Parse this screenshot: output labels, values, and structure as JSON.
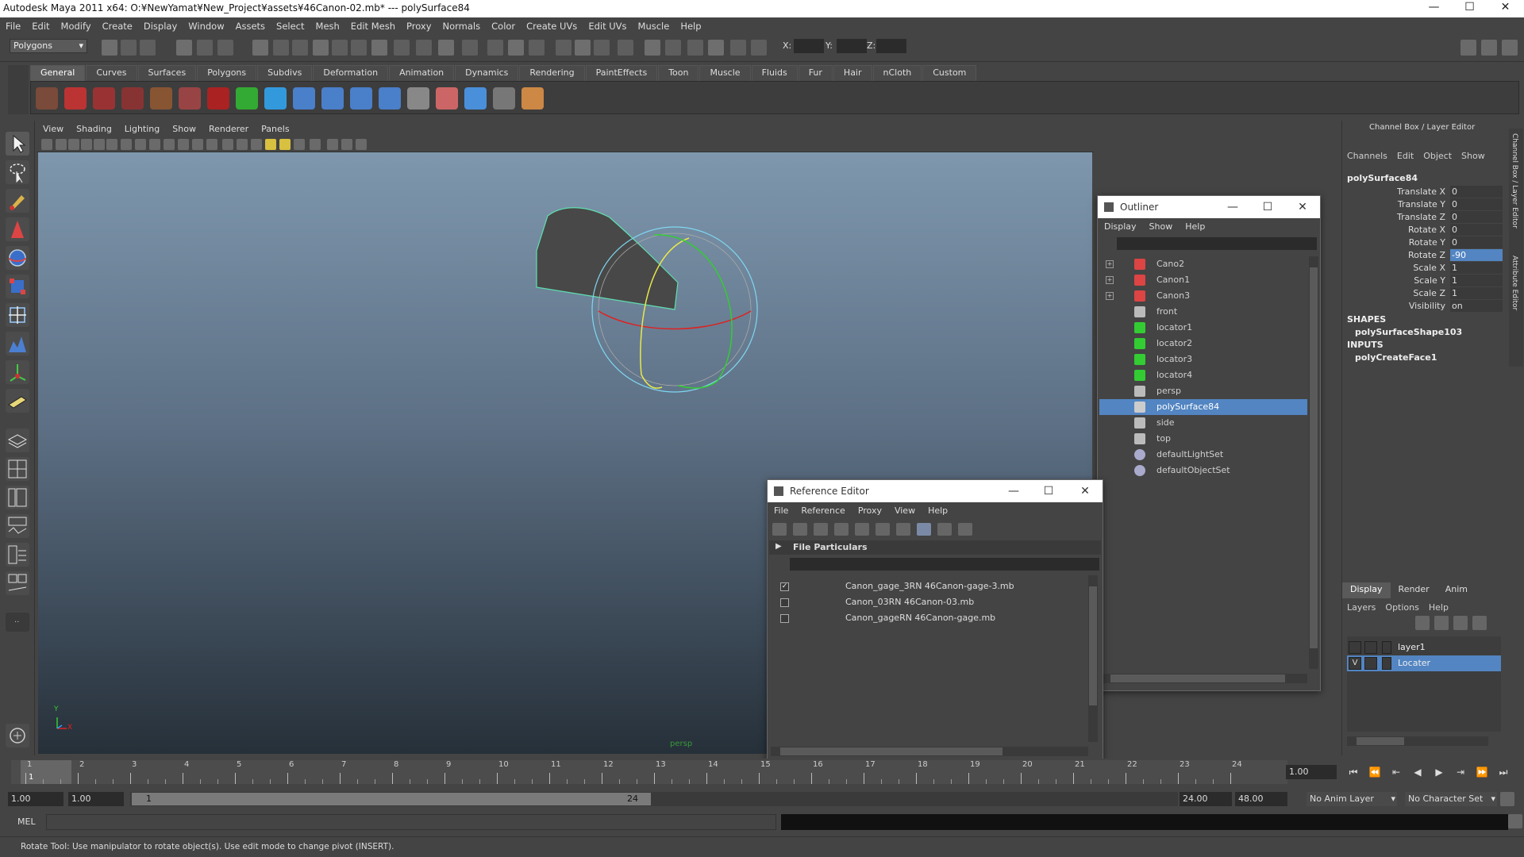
{
  "app": {
    "title": "Autodesk Maya 2011 x64: O:¥NewYamat¥New_Project¥assets¥46Canon-02.mb*   ---   polySurface84",
    "minimize": "—",
    "maximize": "☐",
    "close": "✕"
  },
  "main_menu": [
    "File",
    "Edit",
    "Modify",
    "Create",
    "Display",
    "Window",
    "Assets",
    "Select",
    "Mesh",
    "Edit Mesh",
    "Proxy",
    "Normals",
    "Color",
    "Create UVs",
    "Edit UVs",
    "Muscle",
    "Help"
  ],
  "status_line": {
    "mode": "Polygons",
    "x_label": "X:",
    "y_label": "Y:",
    "z_label": "Z:"
  },
  "shelf_tabs": [
    "General",
    "Curves",
    "Surfaces",
    "Polygons",
    "Subdivs",
    "Deformation",
    "Animation",
    "Dynamics",
    "Rendering",
    "PaintEffects",
    "Toon",
    "Muscle",
    "Fluids",
    "Fur",
    "Hair",
    "nCloth",
    "Custom"
  ],
  "shelf_active": "General",
  "viewport": {
    "menu": [
      "View",
      "Shading",
      "Lighting",
      "Show",
      "Renderer",
      "Panels"
    ],
    "camera_label": "persp",
    "axis_y": "Y",
    "axis_x": "X"
  },
  "outliner": {
    "title": "Outliner",
    "menu": [
      "Display",
      "Show",
      "Help"
    ],
    "items": [
      {
        "label": "Cano2",
        "icon": "transform-icon",
        "expandable": true,
        "selected": false
      },
      {
        "label": "Canon1",
        "icon": "transform-icon",
        "expandable": true,
        "selected": false
      },
      {
        "label": "Canon3",
        "icon": "transform-icon",
        "expandable": true,
        "selected": false
      },
      {
        "label": "front",
        "icon": "camera-icon",
        "expandable": false,
        "selected": false
      },
      {
        "label": "locator1",
        "icon": "locator-icon",
        "expandable": false,
        "selected": false
      },
      {
        "label": "locator2",
        "icon": "locator-icon",
        "expandable": false,
        "selected": false
      },
      {
        "label": "locator3",
        "icon": "locator-icon",
        "expandable": false,
        "selected": false
      },
      {
        "label": "locator4",
        "icon": "locator-icon",
        "expandable": false,
        "selected": false
      },
      {
        "label": "persp",
        "icon": "camera-icon",
        "expandable": false,
        "selected": false
      },
      {
        "label": "polySurface84",
        "icon": "mesh-icon",
        "expandable": false,
        "selected": true
      },
      {
        "label": "side",
        "icon": "camera-icon",
        "expandable": false,
        "selected": false
      },
      {
        "label": "top",
        "icon": "camera-icon",
        "expandable": false,
        "selected": false
      },
      {
        "label": "defaultLightSet",
        "icon": "set-icon",
        "expandable": false,
        "selected": false
      },
      {
        "label": "defaultObjectSet",
        "icon": "set-icon",
        "expandable": false,
        "selected": false
      }
    ]
  },
  "reference_editor": {
    "title": "Reference Editor",
    "menu": [
      "File",
      "Reference",
      "Proxy",
      "View",
      "Help"
    ],
    "section": "File Particulars",
    "rows": [
      {
        "checked": true,
        "label": "Canon_gage_3RN 46Canon-gage-3.mb"
      },
      {
        "checked": false,
        "label": "Canon_03RN 46Canon-03.mb"
      },
      {
        "checked": false,
        "label": "Canon_gageRN 46Canon-gage.mb"
      }
    ]
  },
  "channel_box": {
    "header": "Channel Box / Layer Editor",
    "menu": [
      "Channels",
      "Edit",
      "Object",
      "Show"
    ],
    "object_name": "polySurface84",
    "attributes": [
      {
        "name": "Translate X",
        "value": "0",
        "highlight": false
      },
      {
        "name": "Translate Y",
        "value": "0",
        "highlight": false
      },
      {
        "name": "Translate Z",
        "value": "0",
        "highlight": false
      },
      {
        "name": "Rotate X",
        "value": "0",
        "highlight": false
      },
      {
        "name": "Rotate Y",
        "value": "0",
        "highlight": false
      },
      {
        "name": "Rotate Z",
        "value": "-90",
        "highlight": true
      },
      {
        "name": "Scale X",
        "value": "1",
        "highlight": false
      },
      {
        "name": "Scale Y",
        "value": "1",
        "highlight": false
      },
      {
        "name": "Scale Z",
        "value": "1",
        "highlight": false
      },
      {
        "name": "Visibility",
        "value": "on",
        "highlight": false
      }
    ],
    "shapes_label": "SHAPES",
    "shape_name": "polySurfaceShape103",
    "inputs_label": "INPUTS",
    "input_name": "polyCreateFace1",
    "side_tabs": [
      "Channel Box / Layer Editor",
      "Attribute Editor"
    ]
  },
  "layer_editor": {
    "tabs": [
      "Display",
      "Render",
      "Anim"
    ],
    "active_tab": "Display",
    "menu": [
      "Layers",
      "Options",
      "Help"
    ],
    "layers": [
      {
        "name": "layer1",
        "visible": "",
        "selected": false
      },
      {
        "name": "Locater",
        "visible": "V",
        "selected": true
      }
    ]
  },
  "timeline": {
    "ticks": [
      "1",
      "2",
      "3",
      "4",
      "5",
      "6",
      "7",
      "8",
      "9",
      "10",
      "11",
      "12",
      "13",
      "14",
      "15",
      "16",
      "17",
      "18",
      "19",
      "20",
      "21",
      "22",
      "23",
      "24"
    ],
    "current_frame_marker": "1",
    "current_time": "1.00"
  },
  "range": {
    "start_time": "1.00",
    "playback_start": "1.00",
    "slider_start": "1",
    "slider_end": "24",
    "playback_end": "24.00",
    "end_time": "48.00",
    "anim_layer": "No Anim Layer",
    "character_set": "No Character Set"
  },
  "command_line": {
    "lang": "MEL"
  },
  "help_line": "Rotate Tool: Use manipulator to rotate object(s). Use edit mode to change pivot (INSERT).",
  "colors": {
    "selection": "#5285c2",
    "panel": "#444444",
    "field": "#2b2b2b"
  }
}
